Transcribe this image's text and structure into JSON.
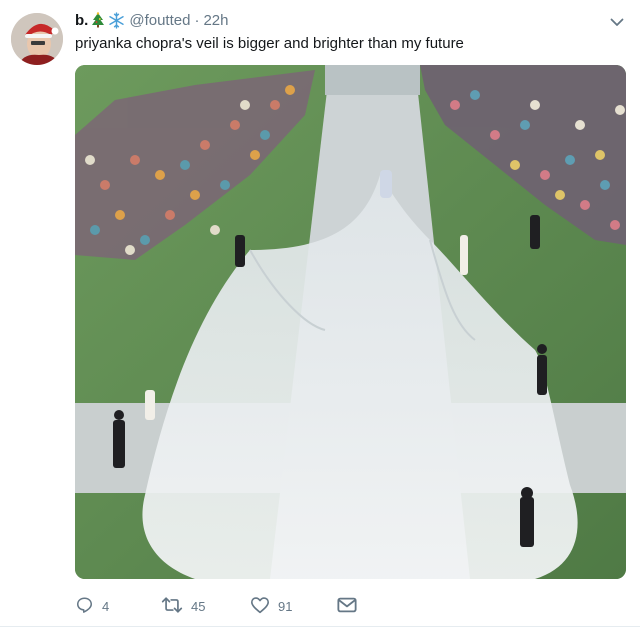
{
  "tweet": {
    "author": {
      "name": "b.",
      "name_emojis": [
        "christmas-tree-icon",
        "snowflake-icon"
      ],
      "handle": "@foutted",
      "separator": "·",
      "time": "22h"
    },
    "text": "priyanka chopra's veil is bigger and brighter than my future",
    "actions": {
      "replies": "4",
      "retweets": "45",
      "likes": "91"
    }
  },
  "colors": {
    "text": "#14171a",
    "secondary": "#657786",
    "grass": "#5d8a52",
    "veil": "#e8ecef",
    "divider": "#e6ecf0"
  }
}
